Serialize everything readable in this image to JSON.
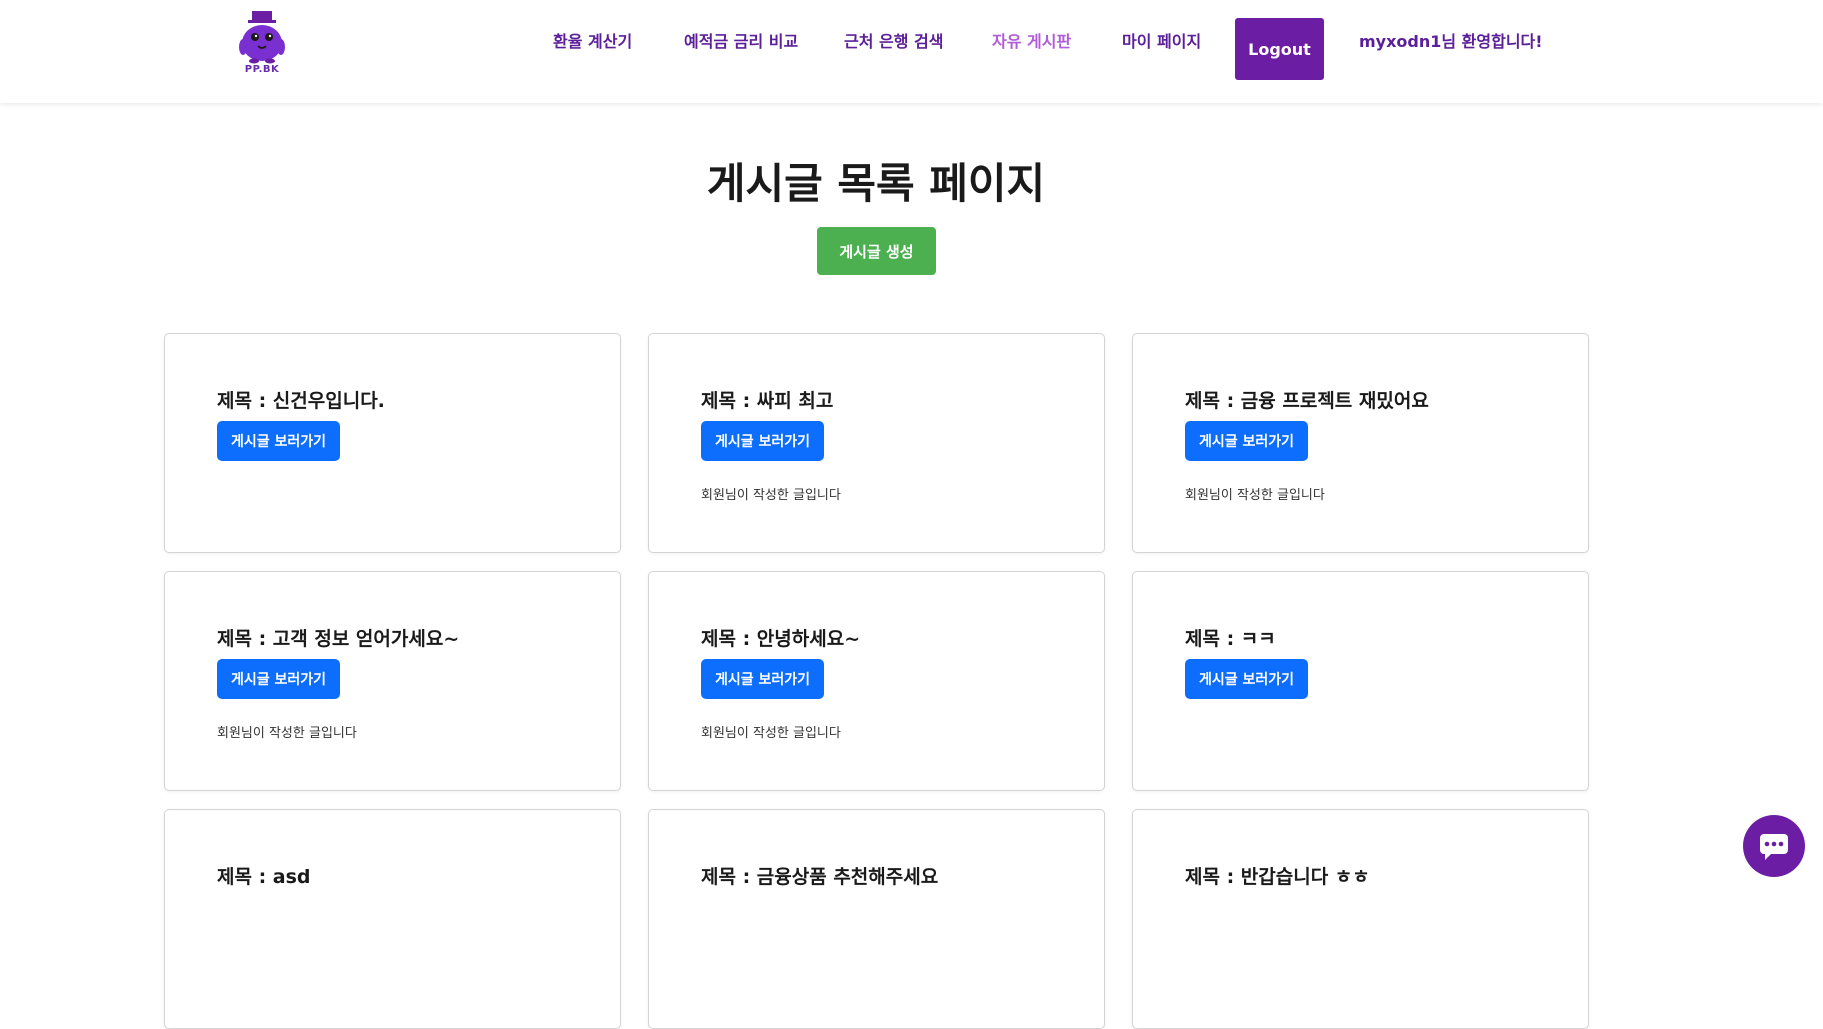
{
  "header": {
    "logo_text": "PP.BK",
    "nav": [
      {
        "label": "환율 계산기"
      },
      {
        "label": "예적금 금리 비교"
      },
      {
        "label": "근처 은행 검색"
      },
      {
        "label": "자유 게시판"
      },
      {
        "label": "마이 페이지"
      }
    ],
    "logout_label": "Logout",
    "welcome": "myxodn1님 환영합니다!"
  },
  "main": {
    "title": "게시글 목록 페이지",
    "create_label": "게시글 생성"
  },
  "posts": [
    {
      "title": "제목 : 신건우입니다.",
      "button": "게시글 보러가기",
      "author": ""
    },
    {
      "title": "제목 : 싸피 최고",
      "button": "게시글 보러가기",
      "author": "회원님이 작성한 글입니다"
    },
    {
      "title": "제목 : 금융 프로젝트 재밌어요",
      "button": "게시글 보러가기",
      "author": "회원님이 작성한 글입니다"
    },
    {
      "title": "제목 : 고객 정보 얻어가세요~",
      "button": "게시글 보러가기",
      "author": "회원님이 작성한 글입니다"
    },
    {
      "title": "제목 : 안녕하세요~",
      "button": "게시글 보러가기",
      "author": "회원님이 작성한 글입니다"
    },
    {
      "title": "제목 : ㅋㅋ",
      "button": "게시글 보러가기",
      "author": ""
    },
    {
      "title": "제목 : asd",
      "button": "",
      "author": ""
    },
    {
      "title": "제목 : 금융상품 추천해주세요",
      "button": "",
      "author": ""
    },
    {
      "title": "제목 : 반갑습니다 ㅎㅎ",
      "button": "",
      "author": ""
    }
  ],
  "colors": {
    "brand_purple": "#6b1ea3",
    "nav_text": "#5a1f99",
    "nav_active": "#b05cd8",
    "create_green": "#4cb050",
    "view_blue": "#0d6efd"
  },
  "icons": {
    "logo": "penguin-mascot-icon",
    "chat": "chat-bubble-icon"
  }
}
